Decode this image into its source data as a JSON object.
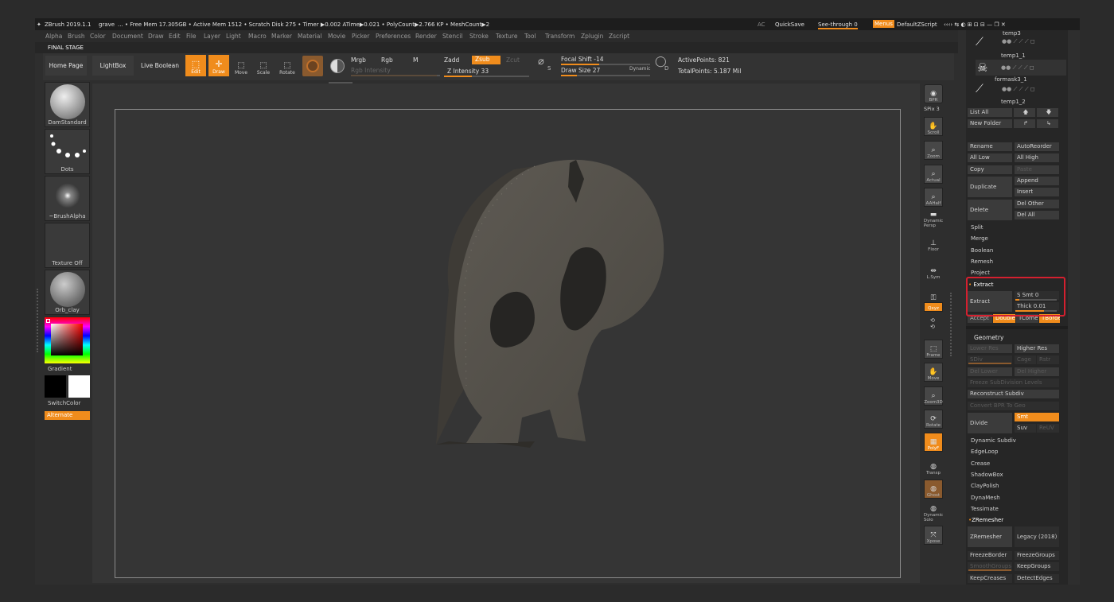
{
  "titlebar": {
    "app": "ZBrush 2019.1.1",
    "doc": "grave",
    "stats": "... • Free Mem 17.305GB • Active Mem 1512 • Scratch Disk 275 • Timer ▶0.002 ATime▶0.021 • PolyCount▶2.766 KP • MeshCount▶2",
    "ac": "AC",
    "quicksave": "QuickSave",
    "seethrough": "See-through  0",
    "menus": "Menus",
    "script": "DefaultZScript"
  },
  "menubar": [
    "Alpha",
    "Brush",
    "Color",
    "Document",
    "Draw",
    "Edit",
    "File",
    "Layer",
    "Light",
    "Macro",
    "Marker",
    "Material",
    "Movie",
    "Picker",
    "Preferences",
    "Render",
    "Stencil",
    "Stroke",
    "Texture",
    "Tool",
    "Transform",
    "Zplugin",
    "Zscript"
  ],
  "stage": "FINAL STAGE",
  "toolbar": {
    "home": "Home Page",
    "lightbox": "LightBox",
    "liveboolean": "Live Boolean",
    "edit": "Edit",
    "draw": "Draw",
    "move": "Move",
    "scale": "Scale",
    "rotate": "Rotate",
    "mrgb": "Mrgb",
    "rgb": "Rgb",
    "m": "M",
    "rgb_intensity": "Rgb Intensity",
    "zadd": "Zadd",
    "zsub": "Zsub",
    "zcut": "Zcut",
    "z_intensity": "Z Intensity 33",
    "focal_shift": "Focal Shift -14",
    "draw_size": "Draw Size 27",
    "dynamic": "Dynamic",
    "active_points": "ActivePoints: 821",
    "total_points": "TotalPoints: 5.187 Mil",
    "s_label": "S",
    "d_label": "D"
  },
  "left": {
    "brush": "DamStandard",
    "stroke": "Dots",
    "alpha": "~BrushAlpha",
    "texture": "Texture Off",
    "material": "Orb_clay",
    "gradient": "Gradient",
    "switchcolor": "SwitchColor",
    "alternate": "Alternate"
  },
  "shelf": [
    "BPR",
    "SPix 3",
    "Scroll",
    "Zoom",
    "Actual",
    "AAHalf",
    "Dynamic Persp",
    "Floor",
    "L.Sym",
    "Qxyz",
    "Frame",
    "Move",
    "Zoom3D",
    "Rotate",
    "PolyF",
    "Transp",
    "Ghost",
    "Dynamic Solo",
    "Xpose"
  ],
  "subtool": {
    "temp3": "temp3",
    "temp1_1": "temp1_1",
    "formask": "formask3_1",
    "temp1_2": "temp1_2",
    "list_all": "List All",
    "new_folder": "New Folder",
    "rename": "Rename",
    "autoreorder": "AutoReorder",
    "all_low": "All Low",
    "all_high": "All High",
    "copy": "Copy",
    "paste": "Paste",
    "duplicate": "Duplicate",
    "append": "Append",
    "insert": "Insert",
    "delete": "Delete",
    "del_other": "Del Other",
    "del_all": "Del All",
    "split": "Split",
    "merge": "Merge",
    "boolean": "Boolean",
    "remesh": "Remesh",
    "project": "Project",
    "extract_header": "Extract",
    "extract_btn": "Extract",
    "s_smt": "S Smt 0",
    "thick": "Thick 0.01",
    "accept": "Accept",
    "double": "Double",
    "tcorne": "TCorne",
    "tborder": "TBorde"
  },
  "geometry": {
    "header": "Geometry",
    "lower_res": "Lower Res",
    "higher_res": "Higher Res",
    "sdiv": "SDiv",
    "cage": "Cage",
    "rstr": "Rstr",
    "del_lower": "Del Lower",
    "del_higher": "Del Higher",
    "freeze_sub": "Freeze SubDivision Levels",
    "reconstruct": "Reconstruct Subdiv",
    "convert_bpr": "Convert BPR To Geo",
    "divide": "Divide",
    "smt": "Smt",
    "suv": "Suv",
    "reuv": "ReUV",
    "dynamic_subdiv": "Dynamic Subdiv",
    "edgeloop": "EdgeLoop",
    "crease": "Crease",
    "shadowbox": "ShadowBox",
    "claypolish": "ClayPolish",
    "dynamesh": "DynaMesh",
    "tessimate": "Tessimate",
    "zremesher_header": "ZRemesher",
    "zremesher": "ZRemesher",
    "legacy": "Legacy (2018)",
    "freezeborder": "FreezeBorder",
    "freezegroups": "FreezeGroups",
    "smoothgroups": "SmoothGroups",
    "keepgroups": "KeepGroups",
    "keepcreases": "KeepCreases",
    "detectedges": "DetectEdges"
  },
  "colors": {
    "accent": "#f08c1c",
    "highlight": "#d4202f"
  }
}
